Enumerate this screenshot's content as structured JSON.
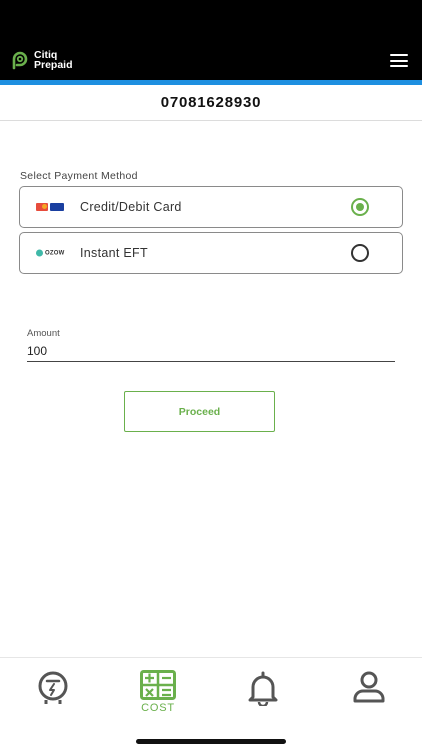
{
  "header": {
    "logo_line1": "Citiq",
    "logo_line2": "Prepaid",
    "menu_icon": "hamburger-icon"
  },
  "account": {
    "number": "07081628930"
  },
  "payment": {
    "section_label": "Select Payment Method",
    "methods": [
      {
        "label": "Credit/Debit Card",
        "icon": "card-logos-icon",
        "selected": true
      },
      {
        "label": "Instant EFT",
        "icon": "ozow-logo-icon",
        "icon_text": "OZOW",
        "selected": false
      }
    ]
  },
  "amount": {
    "label": "Amount",
    "value": "100"
  },
  "proceed_label": "Proceed",
  "nav": {
    "items": [
      {
        "icon": "meter-icon",
        "label": ""
      },
      {
        "icon": "calculator-icon",
        "label": "COST",
        "active": true
      },
      {
        "icon": "bell-icon",
        "label": ""
      },
      {
        "icon": "profile-icon",
        "label": ""
      }
    ]
  },
  "colors": {
    "accent": "#6ab04c",
    "header_bg": "#000000",
    "header_stripe": "#1e8fe0",
    "nav_icon": "#555555"
  }
}
